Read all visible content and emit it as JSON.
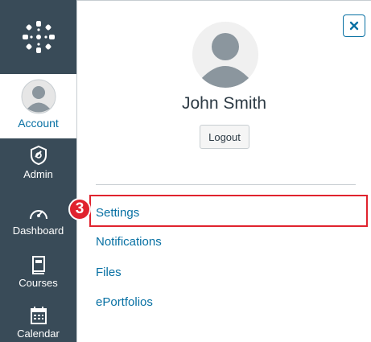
{
  "nav": {
    "items": [
      {
        "label": "Account",
        "icon": "user-avatar-icon",
        "active": true
      },
      {
        "label": "Admin",
        "icon": "shield-icon"
      },
      {
        "label": "Dashboard",
        "icon": "speedometer-icon"
      },
      {
        "label": "Courses",
        "icon": "book-icon"
      },
      {
        "label": "Calendar",
        "icon": "calendar-icon"
      }
    ]
  },
  "tray": {
    "user_name": "John Smith",
    "logout_label": "Logout",
    "close_icon": "close-icon",
    "links": [
      {
        "label": "Settings"
      },
      {
        "label": "Notifications"
      },
      {
        "label": "Files"
      },
      {
        "label": "ePortfolios"
      }
    ]
  },
  "annotation": {
    "step_number": "3"
  },
  "colors": {
    "nav_bg": "#394b58",
    "link": "#0770a3",
    "highlight": "#e0232e",
    "text": "#2d3b45"
  }
}
